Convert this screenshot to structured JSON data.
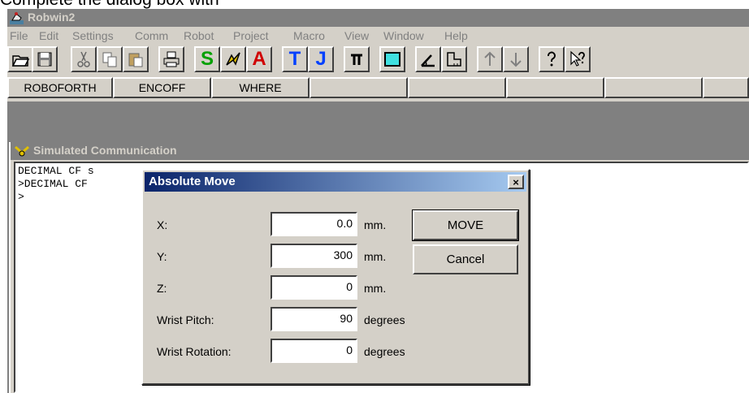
{
  "caption": "Complete the dialog box with",
  "app": {
    "title": "Robwin2"
  },
  "menu": [
    "File",
    "Edit",
    "Settings",
    "Comm",
    "Robot",
    "Project",
    "Macro",
    "View",
    "Window",
    "Help"
  ],
  "toolbar": {
    "buttons": [
      "open-icon",
      "save-icon",
      "cut-icon",
      "copy-icon",
      "paste-icon",
      "print-icon",
      "S",
      "lightning-icon",
      "A",
      "T",
      "J",
      "pi-icon",
      "rectangle-icon",
      "angle-icon",
      "frame-icon",
      "up-arrow-icon",
      "down-arrow-icon",
      "question-icon",
      "help-pointer-icon"
    ],
    "letters": {
      "s": "S",
      "a": "A",
      "t": "T",
      "j": "J"
    }
  },
  "commands": [
    "ROBOFORTH",
    "ENCOFF",
    "WHERE",
    "",
    "",
    "",
    "",
    "",
    ""
  ],
  "child_window": {
    "title": "Simulated Communication",
    "console_lines": [
      "DECIMAL CF s",
      ">DECIMAL CF",
      ">"
    ]
  },
  "dialog": {
    "title": "Absolute Move",
    "close_label": "×",
    "fields": [
      {
        "label": "X:",
        "value": "0.0",
        "unit": "mm."
      },
      {
        "label": "Y:",
        "value": "300",
        "unit": "mm."
      },
      {
        "label": "Z:",
        "value": "0",
        "unit": "mm."
      },
      {
        "label": "Wrist Pitch:",
        "value": "90",
        "unit": "degrees"
      },
      {
        "label": "Wrist Rotation:",
        "value": "0",
        "unit": "degrees"
      }
    ],
    "move_label": "MOVE",
    "cancel_label": "Cancel"
  }
}
